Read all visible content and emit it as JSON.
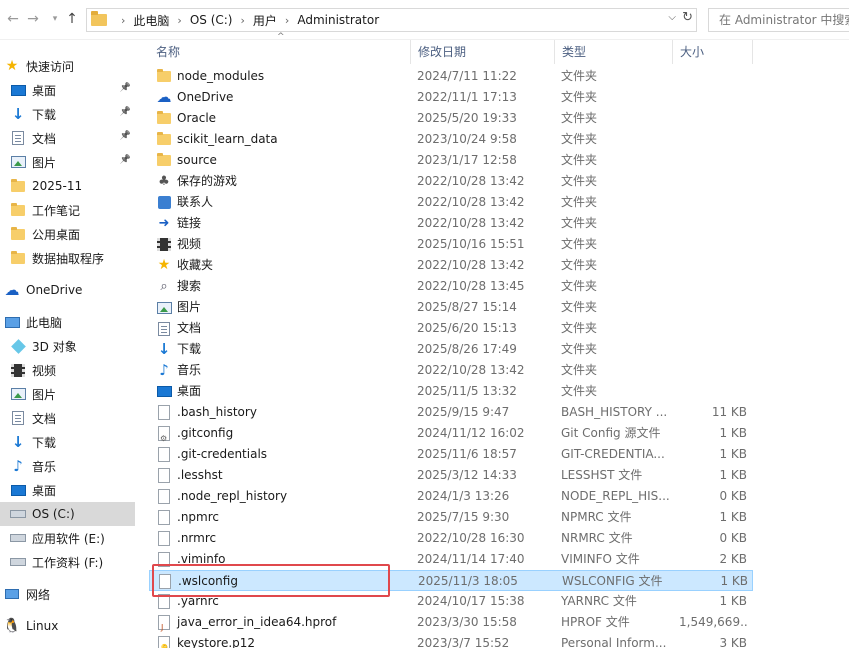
{
  "address": {
    "crumbs": [
      "此电脑",
      "OS (C:)",
      "用户",
      "Administrator"
    ],
    "search_placeholder": "在 Administrator 中搜索"
  },
  "nav": {
    "quick_access": "快速访问",
    "items": [
      {
        "label": "快速访问",
        "icon": "star-icon"
      },
      {
        "label": "桌面",
        "icon": "desktop-icon",
        "pinned": true
      },
      {
        "label": "下载",
        "icon": "download-icon",
        "pinned": true
      },
      {
        "label": "文档",
        "icon": "document-icon",
        "pinned": true
      },
      {
        "label": "图片",
        "icon": "pictures-icon",
        "pinned": true
      },
      {
        "label": "2025-11",
        "icon": "folder-icon"
      },
      {
        "label": "工作笔记",
        "icon": "folder-icon"
      },
      {
        "label": "公用桌面",
        "icon": "folder-icon"
      },
      {
        "label": "数据抽取程序",
        "icon": "folder-icon"
      },
      {
        "label": "OneDrive",
        "icon": "cloud-icon"
      },
      {
        "label": "此电脑",
        "icon": "pc-icon"
      },
      {
        "label": "3D 对象",
        "icon": "3d-objects-icon"
      },
      {
        "label": "视频",
        "icon": "video-icon"
      },
      {
        "label": "图片",
        "icon": "pictures-icon"
      },
      {
        "label": "文档",
        "icon": "document-icon"
      },
      {
        "label": "下载",
        "icon": "download-icon"
      },
      {
        "label": "音乐",
        "icon": "music-icon"
      },
      {
        "label": "桌面",
        "icon": "desktop-icon"
      },
      {
        "label": "OS (C:)",
        "icon": "drive-icon",
        "selected": true
      },
      {
        "label": "应用软件 (E:)",
        "icon": "drive-icon"
      },
      {
        "label": "工作资料 (F:)",
        "icon": "drive-icon"
      },
      {
        "label": "网络",
        "icon": "network-icon"
      },
      {
        "label": "Linux",
        "icon": "linux-icon"
      }
    ]
  },
  "columns": {
    "name": "名称",
    "date": "修改日期",
    "type": "类型",
    "size": "大小"
  },
  "files": [
    {
      "name": "node_modules",
      "date": "2024/7/11 11:22",
      "type": "文件夹",
      "size": "",
      "icon": "folder-icon"
    },
    {
      "name": "OneDrive",
      "date": "2022/11/1 17:13",
      "type": "文件夹",
      "size": "",
      "icon": "cloud-icon"
    },
    {
      "name": "Oracle",
      "date": "2025/5/20 19:33",
      "type": "文件夹",
      "size": "",
      "icon": "folder-icon"
    },
    {
      "name": "scikit_learn_data",
      "date": "2023/10/24 9:58",
      "type": "文件夹",
      "size": "",
      "icon": "folder-icon"
    },
    {
      "name": "source",
      "date": "2023/1/17 12:58",
      "type": "文件夹",
      "size": "",
      "icon": "folder-icon"
    },
    {
      "name": "保存的游戏",
      "date": "2022/10/28 13:42",
      "type": "文件夹",
      "size": "",
      "icon": "game-icon"
    },
    {
      "name": "联系人",
      "date": "2022/10/28 13:42",
      "type": "文件夹",
      "size": "",
      "icon": "contact-icon"
    },
    {
      "name": "链接",
      "date": "2022/10/28 13:42",
      "type": "文件夹",
      "size": "",
      "icon": "link-icon"
    },
    {
      "name": "视频",
      "date": "2025/10/16 15:51",
      "type": "文件夹",
      "size": "",
      "icon": "video-icon"
    },
    {
      "name": "收藏夹",
      "date": "2022/10/28 13:42",
      "type": "文件夹",
      "size": "",
      "icon": "star-icon"
    },
    {
      "name": "搜索",
      "date": "2022/10/28 13:45",
      "type": "文件夹",
      "size": "",
      "icon": "search-icon"
    },
    {
      "name": "图片",
      "date": "2025/8/27 15:14",
      "type": "文件夹",
      "size": "",
      "icon": "pictures-icon"
    },
    {
      "name": "文档",
      "date": "2025/6/20 15:13",
      "type": "文件夹",
      "size": "",
      "icon": "document-icon"
    },
    {
      "name": "下载",
      "date": "2025/8/26 17:49",
      "type": "文件夹",
      "size": "",
      "icon": "download-icon"
    },
    {
      "name": "音乐",
      "date": "2022/10/28 13:42",
      "type": "文件夹",
      "size": "",
      "icon": "music-icon"
    },
    {
      "name": "桌面",
      "date": "2025/11/5 13:32",
      "type": "文件夹",
      "size": "",
      "icon": "desktop-icon"
    },
    {
      "name": ".bash_history",
      "date": "2025/9/15 9:47",
      "type": "BASH_HISTORY ...",
      "size": "11 KB",
      "icon": "file-icon"
    },
    {
      "name": ".gitconfig",
      "date": "2024/11/12 16:02",
      "type": "Git Config 源文件",
      "size": "1 KB",
      "icon": "config-file-icon"
    },
    {
      "name": ".git-credentials",
      "date": "2025/11/6 18:57",
      "type": "GIT-CREDENTIA...",
      "size": "1 KB",
      "icon": "file-icon"
    },
    {
      "name": ".lesshst",
      "date": "2025/3/12 14:33",
      "type": "LESSHST 文件",
      "size": "1 KB",
      "icon": "file-icon"
    },
    {
      "name": ".node_repl_history",
      "date": "2024/1/3 13:26",
      "type": "NODE_REPL_HIS...",
      "size": "0 KB",
      "icon": "file-icon"
    },
    {
      "name": ".npmrc",
      "date": "2025/7/15 9:30",
      "type": "NPMRC 文件",
      "size": "1 KB",
      "icon": "file-icon"
    },
    {
      "name": ".nrmrc",
      "date": "2022/10/28 16:30",
      "type": "NRMRC 文件",
      "size": "0 KB",
      "icon": "file-icon"
    },
    {
      "name": ".viminfo",
      "date": "2024/11/14 17:40",
      "type": "VIMINFO 文件",
      "size": "2 KB",
      "icon": "file-icon"
    },
    {
      "name": ".wslconfig",
      "date": "2025/11/3 18:05",
      "type": "WSLCONFIG 文件",
      "size": "1 KB",
      "icon": "file-icon",
      "selected": true
    },
    {
      "name": ".yarnrc",
      "date": "2024/10/17 15:38",
      "type": "YARNRC 文件",
      "size": "1 KB",
      "icon": "file-icon"
    },
    {
      "name": "java_error_in_idea64.hprof",
      "date": "2023/3/30 15:58",
      "type": "HPROF 文件",
      "size": "1,549,669...",
      "icon": "java-file-icon"
    },
    {
      "name": "keystore.p12",
      "date": "2023/3/7 15:52",
      "type": "Personal Inform...",
      "size": "3 KB",
      "icon": "key-file-icon"
    }
  ],
  "colors": {
    "selection_bg": "#cce8ff",
    "selection_border": "#99d1ff",
    "annotation_red": "#e0484c",
    "header_text": "#4d6082"
  }
}
